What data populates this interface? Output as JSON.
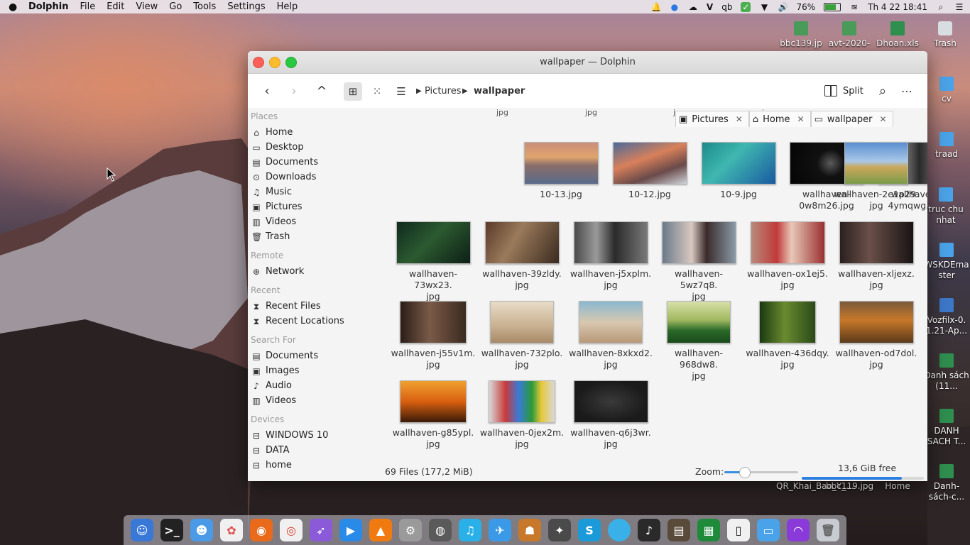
{
  "menubar": {
    "apple": "",
    "items": [
      "Dolphin",
      "File",
      "Edit",
      "View",
      "Go",
      "Tools",
      "Settings",
      "Help"
    ],
    "status": {
      "battery": "76%",
      "datetime": "Th 4 22  18:41",
      "input1": "V",
      "input2": "ꝗb"
    }
  },
  "desktop": {
    "top_icons": [
      {
        "label": "bbc139.jp",
        "type": "img"
      },
      {
        "label": "avt-2020-",
        "type": "img"
      },
      {
        "label": "Dhoan.xls",
        "type": "xls"
      },
      {
        "label": "Trash",
        "type": "trash"
      }
    ],
    "right_icons": [
      {
        "label": "cv",
        "type": "folder"
      },
      {
        "label": "traad",
        "type": "folder"
      },
      {
        "label": "truc chu nhat",
        "type": "folder"
      },
      {
        "label": "WSKDEmaster",
        "type": "folder"
      },
      {
        "label": "Vozfilx-0.1.21-Ap...",
        "type": "doc"
      },
      {
        "label": "Danh sách (11...",
        "type": "xls"
      },
      {
        "label": "DANH SACH T...",
        "type": "xls"
      },
      {
        "label": "Danh-sách-c...",
        "type": "xls"
      }
    ],
    "bottom_labels": [
      "QR_Khai_Bao_Y_...",
      "bbc119.jpg",
      "Home"
    ]
  },
  "window": {
    "title": "wallpaper — Dolphin",
    "breadcrumb": [
      "Pictures",
      "wallpaper"
    ],
    "split_label": "Split"
  },
  "sidebar": {
    "places_header": "Places",
    "places": [
      "Home",
      "Desktop",
      "Documents",
      "Downloads",
      "Music",
      "Pictures",
      "Videos",
      "Trash"
    ],
    "remote_header": "Remote",
    "remote": [
      "Network"
    ],
    "recent_header": "Recent",
    "recent": [
      "Recent Files",
      "Recent Locations"
    ],
    "search_header": "Search For",
    "search": [
      "Documents",
      "Images",
      "Audio",
      "Videos"
    ],
    "devices_header": "Devices",
    "devices": [
      "WINDOWS 10",
      "DATA",
      "home"
    ]
  },
  "tabs": [
    "Pictures",
    "Home",
    "wallpaper"
  ],
  "partial_row": [
    "jpg",
    "jpg",
    "jpg",
    "jpg"
  ],
  "files": [
    {
      "name1": "10-13.jpg",
      "name2": ""
    },
    {
      "name1": "10-12.jpg",
      "name2": ""
    },
    {
      "name1": "10-9.jpg",
      "name2": ""
    },
    {
      "name1": "wallhaven-",
      "name2": "0w8m26.jpg"
    },
    {
      "name1": "wallhaven-",
      "name2": "4ymqwg.jpg"
    },
    {
      "name1": "wallhaven-2e1p29.",
      "name2": "jpg"
    },
    {
      "name1": "wallhaven-73wx23.",
      "name2": "jpg"
    },
    {
      "name1": "wallhaven-39zldy.",
      "name2": "jpg"
    },
    {
      "name1": "wallhaven-j5xplm.",
      "name2": "jpg"
    },
    {
      "name1": "wallhaven-5wz7q8.",
      "name2": "jpg"
    },
    {
      "name1": "wallhaven-ox1ej5.",
      "name2": "jpg"
    },
    {
      "name1": "wallhaven-xljexz.",
      "name2": "jpg"
    },
    {
      "name1": "wallhaven-j55v1m.",
      "name2": "jpg"
    },
    {
      "name1": "wallhaven-732plo.",
      "name2": "jpg"
    },
    {
      "name1": "wallhaven-8xkxd2.",
      "name2": "jpg"
    },
    {
      "name1": "wallhaven-968dw8.",
      "name2": "jpg"
    },
    {
      "name1": "wallhaven-436dqy.",
      "name2": "jpg"
    },
    {
      "name1": "wallhaven-od7dol.",
      "name2": "jpg"
    },
    {
      "name1": "wallhaven-g85ypl.",
      "name2": "jpg"
    },
    {
      "name1": "wallhaven-0jex2m.",
      "name2": "jpg"
    },
    {
      "name1": "wallhaven-q6j3wr.",
      "name2": "jpg"
    }
  ],
  "status": {
    "count": "69 Files (177,2 MiB)",
    "zoom_label": "Zoom:",
    "zoom_level": 0.27,
    "free": "13,6 GiB free",
    "used_fraction": 0.82
  }
}
